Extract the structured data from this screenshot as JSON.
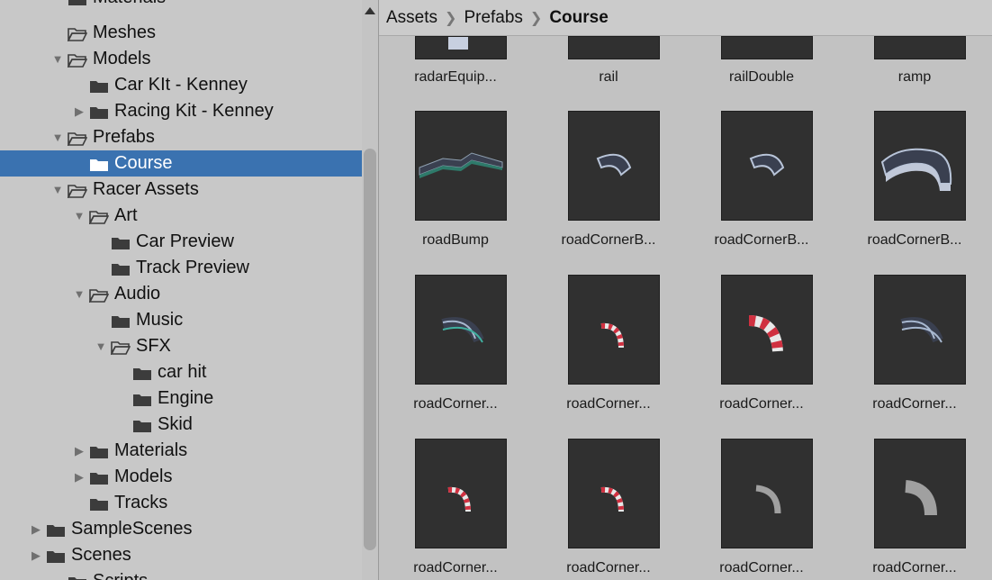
{
  "tree": {
    "items": [
      {
        "label": "Materials",
        "depth": 1,
        "arrow": "none",
        "open": false,
        "partial": true
      },
      {
        "label": "Meshes",
        "depth": 1,
        "arrow": "none",
        "open": true
      },
      {
        "label": "Models",
        "depth": 1,
        "arrow": "down",
        "open": true
      },
      {
        "label": "Car KIt - Kenney",
        "depth": 2,
        "arrow": "none",
        "open": false
      },
      {
        "label": "Racing Kit - Kenney",
        "depth": 2,
        "arrow": "right",
        "open": false
      },
      {
        "label": "Prefabs",
        "depth": 1,
        "arrow": "down",
        "open": true
      },
      {
        "label": "Course",
        "depth": 2,
        "arrow": "none",
        "open": false,
        "selected": true
      },
      {
        "label": "Racer Assets",
        "depth": 1,
        "arrow": "down",
        "open": true
      },
      {
        "label": "Art",
        "depth": 2,
        "arrow": "down",
        "open": true
      },
      {
        "label": "Car Preview",
        "depth": 3,
        "arrow": "none",
        "open": false
      },
      {
        "label": "Track Preview",
        "depth": 3,
        "arrow": "none",
        "open": false
      },
      {
        "label": "Audio",
        "depth": 2,
        "arrow": "down",
        "open": true
      },
      {
        "label": "Music",
        "depth": 3,
        "arrow": "none",
        "open": false
      },
      {
        "label": "SFX",
        "depth": 3,
        "arrow": "down",
        "open": true
      },
      {
        "label": "car hit",
        "depth": 4,
        "arrow": "none",
        "open": false
      },
      {
        "label": "Engine",
        "depth": 4,
        "arrow": "none",
        "open": false
      },
      {
        "label": "Skid",
        "depth": 4,
        "arrow": "none",
        "open": false
      },
      {
        "label": "Materials",
        "depth": 2,
        "arrow": "right",
        "open": false
      },
      {
        "label": "Models",
        "depth": 2,
        "arrow": "right",
        "open": false
      },
      {
        "label": "Tracks",
        "depth": 2,
        "arrow": "none",
        "open": false
      },
      {
        "label": "SampleScenes",
        "depth": 0,
        "arrow": "right",
        "open": false
      },
      {
        "label": "Scenes",
        "depth": 0,
        "arrow": "right",
        "open": false
      },
      {
        "label": "Scripts",
        "depth": 1,
        "arrow": "none",
        "open": false,
        "partial": true
      }
    ]
  },
  "breadcrumb": {
    "items": [
      "Assets",
      "Prefabs",
      "Course"
    ]
  },
  "assets": [
    {
      "label": "radarEquip...",
      "shape": "radar"
    },
    {
      "label": "rail",
      "shape": "none"
    },
    {
      "label": "railDouble",
      "shape": "none"
    },
    {
      "label": "ramp",
      "shape": "none"
    },
    {
      "label": "roadBump",
      "shape": "bump"
    },
    {
      "label": "roadCornerB...",
      "shape": "cornerBig"
    },
    {
      "label": "roadCornerB...",
      "shape": "cornerBig"
    },
    {
      "label": "roadCornerB...",
      "shape": "cornerWide"
    },
    {
      "label": "roadCorner...",
      "shape": "cornerDoubleTeal"
    },
    {
      "label": "roadCorner...",
      "shape": "stripeThin"
    },
    {
      "label": "roadCorner...",
      "shape": "stripeThick"
    },
    {
      "label": "roadCorner...",
      "shape": "cornerDouble"
    },
    {
      "label": "roadCorner...",
      "shape": "stripeThin"
    },
    {
      "label": "roadCorner...",
      "shape": "stripeThin"
    },
    {
      "label": "roadCorner...",
      "shape": "greyThin"
    },
    {
      "label": "roadCorner...",
      "shape": "greyThick"
    }
  ],
  "colors": {
    "selection": "#3a72b0",
    "thumbnail_bg": "#303030",
    "road": "#3a4050",
    "stripe_red": "#d03040",
    "stripe_white": "#e8e8e8",
    "teal": "#40b0a0"
  }
}
